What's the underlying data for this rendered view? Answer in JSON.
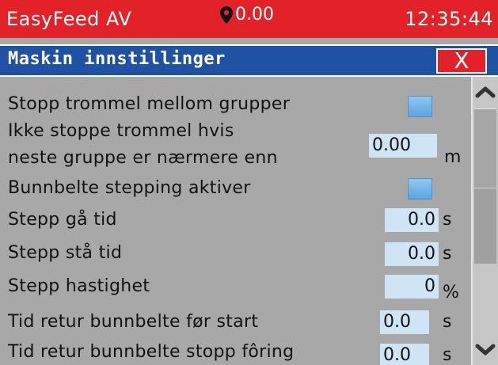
{
  "status": {
    "app_name": "EasyFeed AV",
    "location_value": "0.00",
    "time": "12:35:44"
  },
  "window": {
    "title": "Maskin innstillinger",
    "close_label": "X"
  },
  "settings": [
    {
      "label": "Stopp trommel mellom grupper"
    },
    {
      "label_line1": "Ikke stoppe trommel hvis",
      "label_line2": "neste gruppe er nærmere enn",
      "value": "0.00",
      "unit": "m"
    },
    {
      "label": "Bunnbelte stepping aktiver"
    },
    {
      "label": "Stepp gå tid",
      "value": "0.0",
      "unit": "s"
    },
    {
      "label": "Stepp stå tid",
      "value": "0.0",
      "unit": "s"
    },
    {
      "label": "Stepp hastighet",
      "value": "0",
      "unit": "%"
    },
    {
      "label": "Tid retur bunnbelte før start",
      "value": "0.0",
      "unit": "s"
    },
    {
      "label": "Tid retur bunnbelte stopp fôring",
      "value": "0.0",
      "unit": "s"
    }
  ],
  "colors": {
    "status_bar": "#e32128",
    "title_bar": "#1f52a3",
    "background": "#a8a8a8",
    "value_field": "#cfe5f5",
    "checkbox": "#6fb3ea"
  },
  "icons": {
    "location": "map-pin-icon",
    "close": "close-icon",
    "scroll_up": "chevron-up-icon",
    "scroll_down": "chevron-down-icon"
  }
}
